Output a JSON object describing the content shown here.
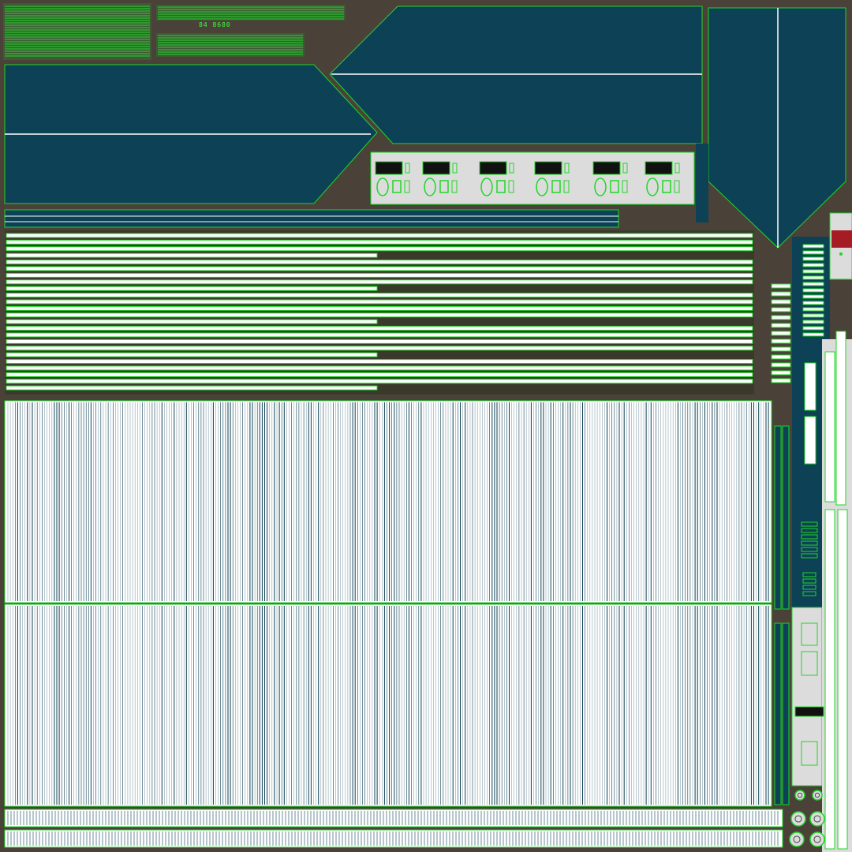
{
  "texture": {
    "colors": {
      "ground": "#4a4238",
      "panel": "#0d4156",
      "outline": "#1fd626",
      "strip": "#ffffff",
      "light_panel": "#dcdcdc",
      "marker": "#a51c24"
    },
    "tiny_label": "84 8680"
  }
}
